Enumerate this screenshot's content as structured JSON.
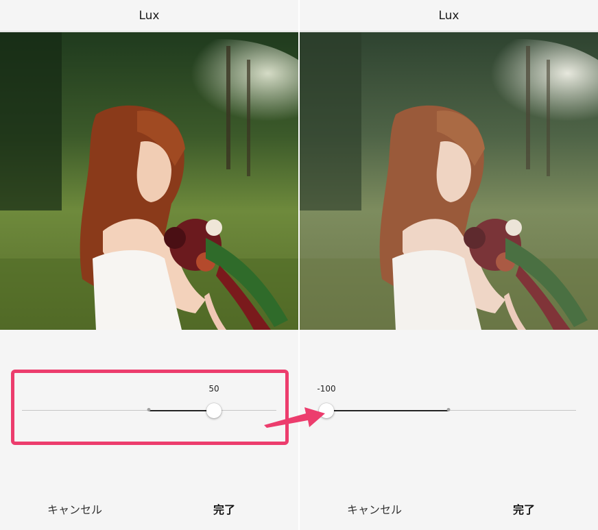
{
  "left_panel": {
    "title": "Lux",
    "slider": {
      "value_label": "50",
      "value": 50,
      "min": -100,
      "max": 100
    },
    "cancel_label": "キャンセル",
    "done_label": "完了"
  },
  "right_panel": {
    "title": "Lux",
    "slider": {
      "value_label": "-100",
      "value": -100,
      "min": -100,
      "max": 100
    },
    "cancel_label": "キャンセル",
    "done_label": "完了"
  },
  "colors": {
    "accent_highlight": "#ec3d6d",
    "track": "#c6c6c6",
    "fill": "#222222"
  }
}
